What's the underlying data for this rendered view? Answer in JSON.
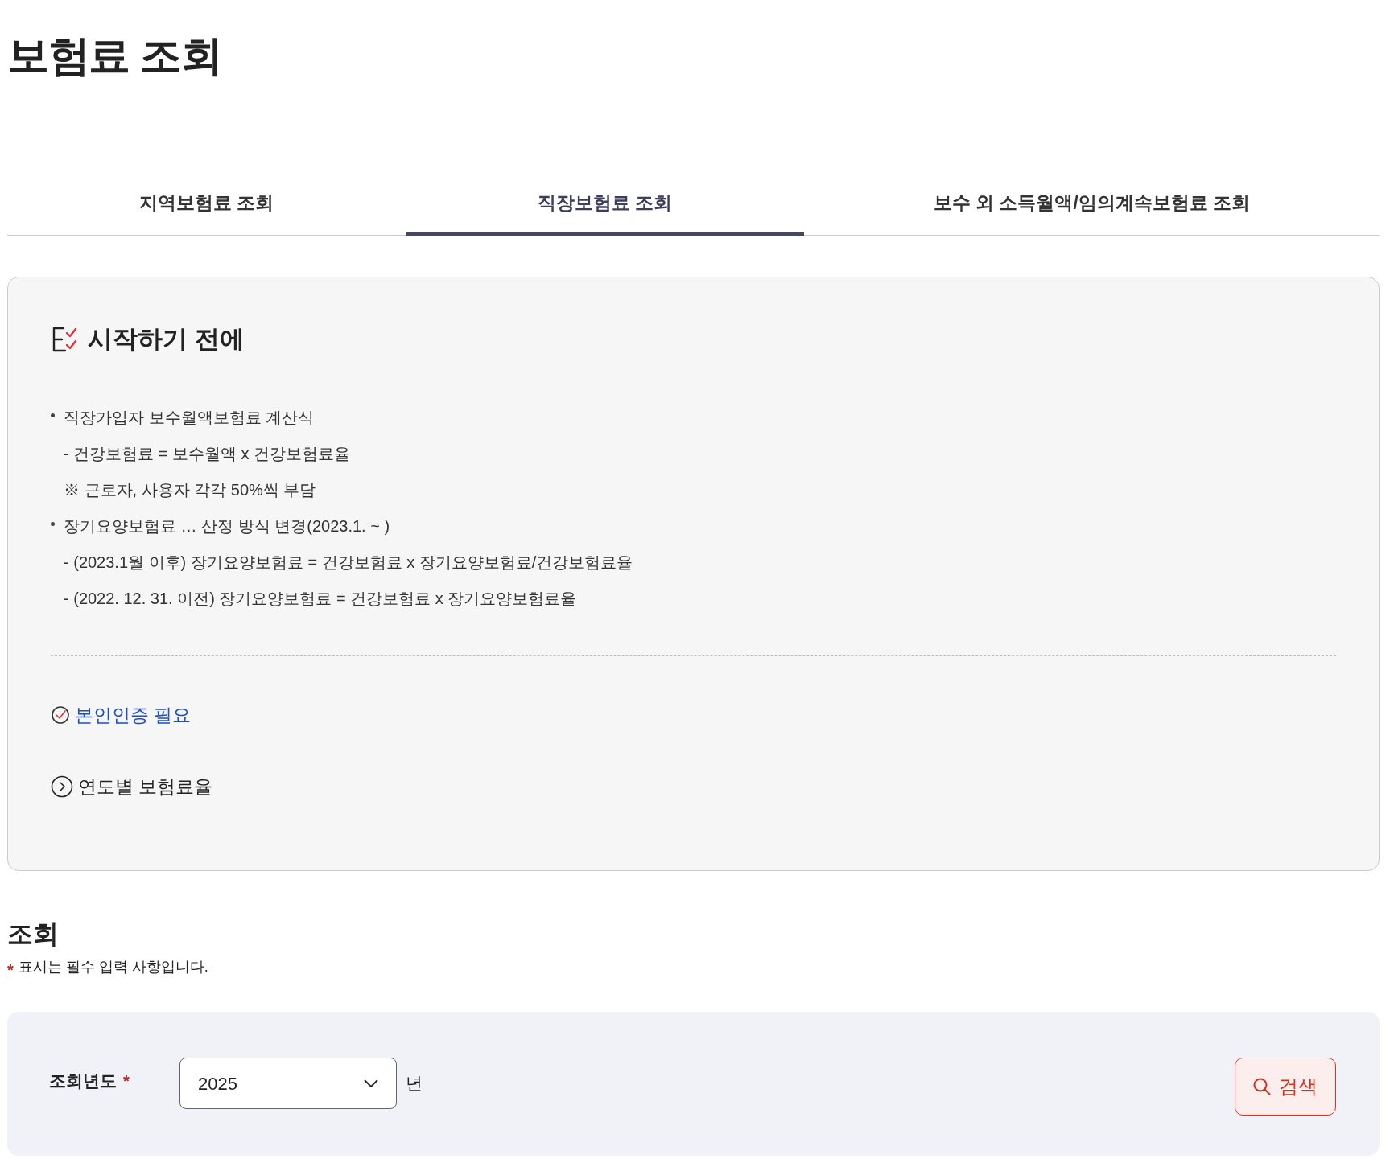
{
  "page_title": "보험료 조회",
  "tabs": [
    {
      "label": "지역보험료 조회",
      "selected": false
    },
    {
      "label": "직장보험료 조회",
      "selected": true
    },
    {
      "label": "보수 외 소득월액/임의계속보험료 조회",
      "selected": false
    }
  ],
  "notice": {
    "title": "시작하기 전에",
    "lines": [
      {
        "kind": "bullet",
        "text": "직장가입자 보수월액보험료 계산식"
      },
      {
        "kind": "sub",
        "text": "- 건강보험료 = 보수월액 x 건강보험료율"
      },
      {
        "kind": "sub",
        "text": "※ 근로자, 사용자 각각 50%씩 부담"
      },
      {
        "kind": "bullet",
        "text": "장기요양보험료 … 산정 방식 변경(2023.1. ~ )"
      },
      {
        "kind": "sub",
        "text": "- (2023.1월 이후) 장기요양보험료 = 건강보험료 x 장기요양보험료/건강보험료율"
      },
      {
        "kind": "sub",
        "text": "- (2022. 12. 31. 이전) 장기요양보험료 = 건강보험료 x 장기요양보험료율"
      }
    ],
    "links": [
      {
        "kind": "check",
        "label": "본인인증 필요"
      },
      {
        "kind": "arrow",
        "label": "연도별 보험료율"
      }
    ]
  },
  "search": {
    "title": "조회",
    "required_mark": "*",
    "note": "표시는 필수 입력 사항입니다.",
    "fields": [
      {
        "label": "조회년도",
        "required": true,
        "value": "2025",
        "unit": "년"
      }
    ],
    "button": "검색"
  }
}
